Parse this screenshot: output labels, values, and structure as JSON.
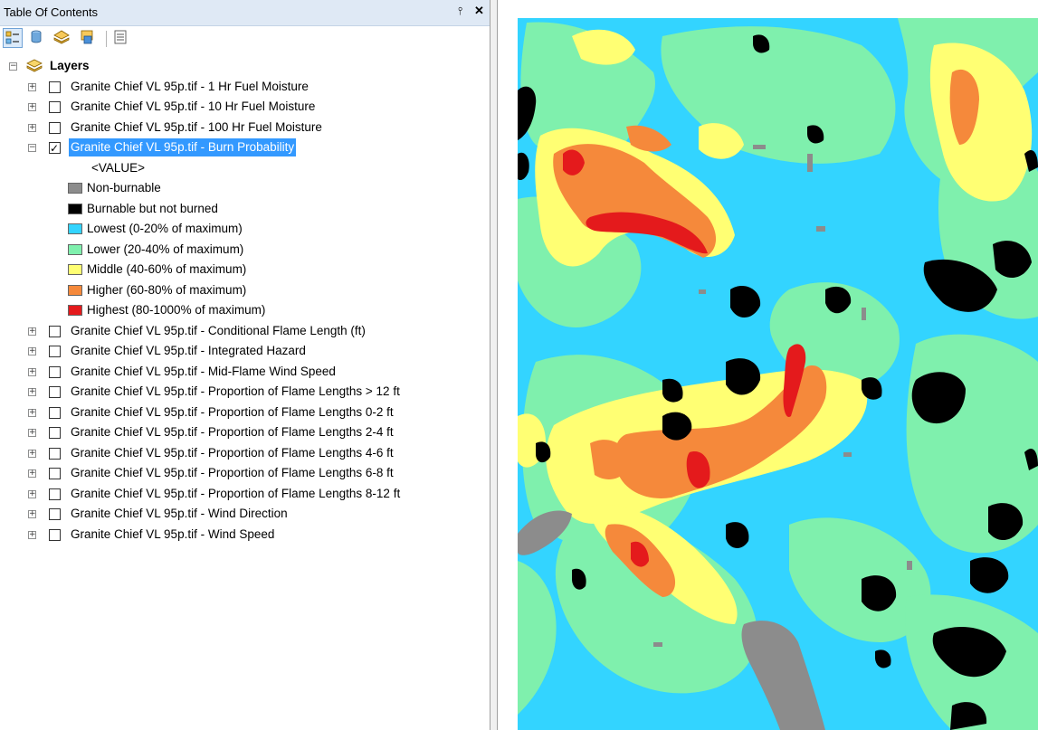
{
  "toc": {
    "title": "Table Of Contents",
    "pin_glyph": "⫯",
    "close_glyph": "✕",
    "toolbar_icons": [
      "list-by-drawing-order-icon",
      "list-by-source-icon",
      "list-by-visibility-icon",
      "list-by-selection-icon",
      "options-icon"
    ],
    "root": {
      "label": "Layers",
      "expand_glyph": "−"
    },
    "layers_before": [
      {
        "label": "Granite Chief VL 95p.tif - 1 Hr Fuel Moisture",
        "checked": false
      },
      {
        "label": "Granite Chief VL 95p.tif - 10 Hr Fuel Moisture",
        "checked": false
      },
      {
        "label": "Granite Chief VL 95p.tif - 100 Hr Fuel Moisture",
        "checked": false
      }
    ],
    "selected_layer": {
      "label": "Granite Chief VL 95p.tif - Burn Probability",
      "checked": true
    },
    "legend_field": "<VALUE>",
    "legend": [
      {
        "label": "Non-burnable",
        "color": "#8c8c8c"
      },
      {
        "label": "Burnable but not burned",
        "color": "#000000"
      },
      {
        "label": "Lowest (0-20% of maximum)",
        "color": "#33d4ff"
      },
      {
        "label": "Lower (20-40% of maximum)",
        "color": "#7ff0ad"
      },
      {
        "label": "Middle (40-60% of maximum)",
        "color": "#ffff73"
      },
      {
        "label": "Higher (60-80% of maximum)",
        "color": "#f5893b"
      },
      {
        "label": "Highest (80-1000% of maximum)",
        "color": "#e41a1c"
      }
    ],
    "layers_after": [
      {
        "label": "Granite Chief VL 95p.tif - Conditional Flame Length (ft)",
        "checked": false
      },
      {
        "label": "Granite Chief VL 95p.tif - Integrated Hazard",
        "checked": false
      },
      {
        "label": "Granite Chief VL 95p.tif - Mid-Flame Wind Speed",
        "checked": false
      },
      {
        "label": "Granite Chief VL 95p.tif - Proportion of Flame Lengths > 12 ft",
        "checked": false
      },
      {
        "label": "Granite Chief VL 95p.tif - Proportion of Flame Lengths 0-2 ft",
        "checked": false
      },
      {
        "label": "Granite Chief VL 95p.tif - Proportion of Flame Lengths 2-4 ft",
        "checked": false
      },
      {
        "label": "Granite Chief VL 95p.tif - Proportion of Flame Lengths 4-6 ft",
        "checked": false
      },
      {
        "label": "Granite Chief VL 95p.tif - Proportion of Flame Lengths 6-8 ft",
        "checked": false
      },
      {
        "label": "Granite Chief VL 95p.tif - Proportion of Flame Lengths 8-12 ft",
        "checked": false
      },
      {
        "label": "Granite Chief VL 95p.tif - Wind Direction",
        "checked": false
      },
      {
        "label": "Granite Chief VL 95p.tif - Wind Speed",
        "checked": false
      }
    ]
  },
  "map": {
    "colors": {
      "lowest": "#33d4ff",
      "lower": "#7ff0ad",
      "middle": "#ffff73",
      "higher": "#f5893b",
      "highest": "#e41a1c",
      "nonburnable": "#8c8c8c",
      "unburned": "#000000"
    }
  }
}
